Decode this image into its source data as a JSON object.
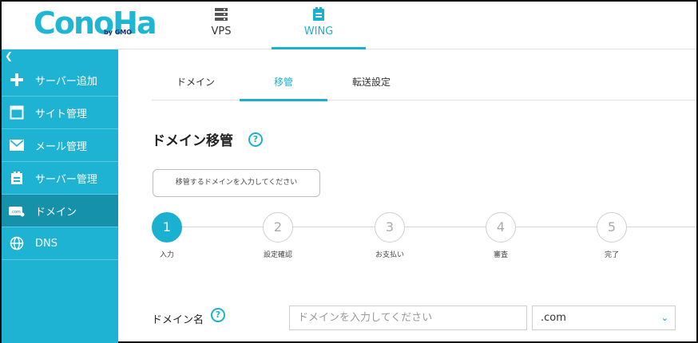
{
  "header": {
    "logo_text": "ConoHa",
    "logo_sub": "by GMO",
    "nav": [
      {
        "label": "VPS",
        "icon": "server-icon"
      },
      {
        "label": "WING",
        "icon": "wing-icon"
      }
    ]
  },
  "sidebar": {
    "collapse_glyph": "❮",
    "items": [
      {
        "label": "サーバー追加",
        "icon": "plus-icon"
      },
      {
        "label": "サイト管理",
        "icon": "window-icon"
      },
      {
        "label": "メール管理",
        "icon": "mail-icon"
      },
      {
        "label": "サーバー管理",
        "icon": "server-manage-icon"
      },
      {
        "label": "ドメイン",
        "icon": "domain-icon",
        "active": true
      },
      {
        "label": "DNS",
        "icon": "globe-icon"
      }
    ]
  },
  "tabs": [
    {
      "label": "ドメイン"
    },
    {
      "label": "移管",
      "active": true
    },
    {
      "label": "転送設定"
    }
  ],
  "page": {
    "title": "ドメイン移管",
    "help_glyph": "?",
    "tooltip": "移管するドメインを入力してください"
  },
  "steps": [
    {
      "num": "1",
      "label": "入力",
      "current": true
    },
    {
      "num": "2",
      "label": "設定確認"
    },
    {
      "num": "3",
      "label": "お支払い"
    },
    {
      "num": "4",
      "label": "審査"
    },
    {
      "num": "5",
      "label": "完了"
    }
  ],
  "form": {
    "label": "ドメイン名",
    "placeholder": "ドメインを入力してください",
    "value": "",
    "tld_selected": ".com",
    "chevron": "⌄"
  },
  "colors": {
    "accent": "#1ab0cf",
    "sidebar": "#1eb3d2",
    "sidebar_active": "#1591ab"
  }
}
